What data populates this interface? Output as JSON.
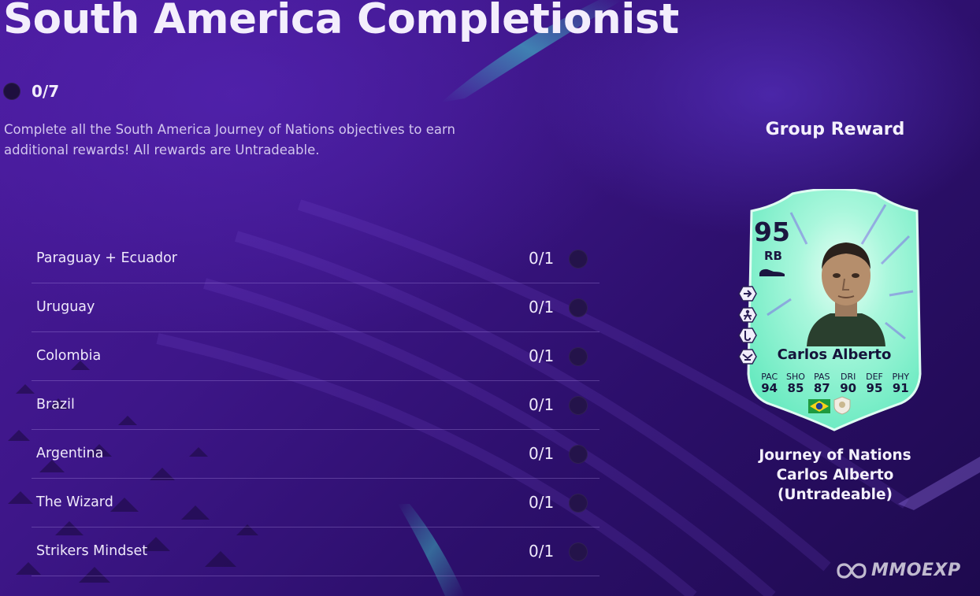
{
  "page": {
    "title": "South America Completionist",
    "progress": "0/7",
    "description": "Complete all the South America Journey of Nations objectives to earn additional rewards! All rewards are Untradeable."
  },
  "objectives": [
    {
      "label": "Paraguay + Ecuador",
      "progress": "0/1"
    },
    {
      "label": "Uruguay",
      "progress": "0/1"
    },
    {
      "label": "Colombia",
      "progress": "0/1"
    },
    {
      "label": "Brazil",
      "progress": "0/1"
    },
    {
      "label": "Argentina",
      "progress": "0/1"
    },
    {
      "label": "The Wizard",
      "progress": "0/1"
    },
    {
      "label": "Strikers Mindset",
      "progress": "0/1"
    }
  ],
  "reward": {
    "heading": "Group Reward",
    "card": {
      "rating": "95",
      "position": "RB",
      "name": "Carlos Alberto",
      "stats": [
        {
          "label": "PAC",
          "value": "94"
        },
        {
          "label": "SHO",
          "value": "85"
        },
        {
          "label": "PAS",
          "value": "87"
        },
        {
          "label": "DRI",
          "value": "90"
        },
        {
          "label": "DEF",
          "value": "95"
        },
        {
          "label": "PHY",
          "value": "91"
        }
      ],
      "nation_flag": "brazil-flag-icon",
      "club_badge": "icon-badge",
      "card_color": "#6ef0c4"
    },
    "name_lines": [
      "Journey of Nations",
      "Carlos Alberto",
      "(Untradeable)"
    ]
  },
  "watermark": {
    "text": "MMOEXP"
  },
  "colors": {
    "background": "#3d1688",
    "accent_glow": "#3fd6d0",
    "card_text": "#15133a"
  }
}
